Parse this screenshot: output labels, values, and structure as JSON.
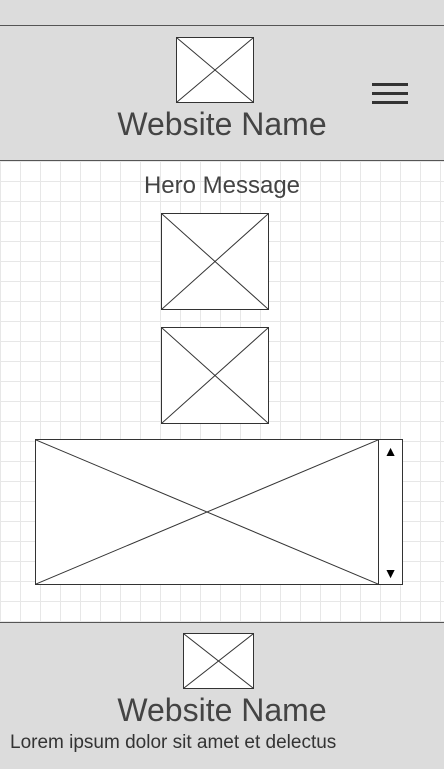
{
  "header": {
    "logo_icon": "image-placeholder-icon",
    "site_name": "Website Name",
    "menu_icon": "hamburger-menu-icon"
  },
  "hero": {
    "message": "Hero Message",
    "images": [
      "image-placeholder-icon",
      "image-placeholder-icon"
    ],
    "banner_icon": "image-placeholder-icon",
    "scrollbar": {
      "up_glyph": "▲",
      "down_glyph": "▼"
    }
  },
  "footer": {
    "logo_icon": "image-placeholder-icon",
    "site_name": "Website Name",
    "text": "Lorem ipsum dolor sit amet et delectus"
  },
  "colors": {
    "chrome_background": "#dcdcdc",
    "grid_line": "#e7e7e7",
    "text": "#444444"
  }
}
